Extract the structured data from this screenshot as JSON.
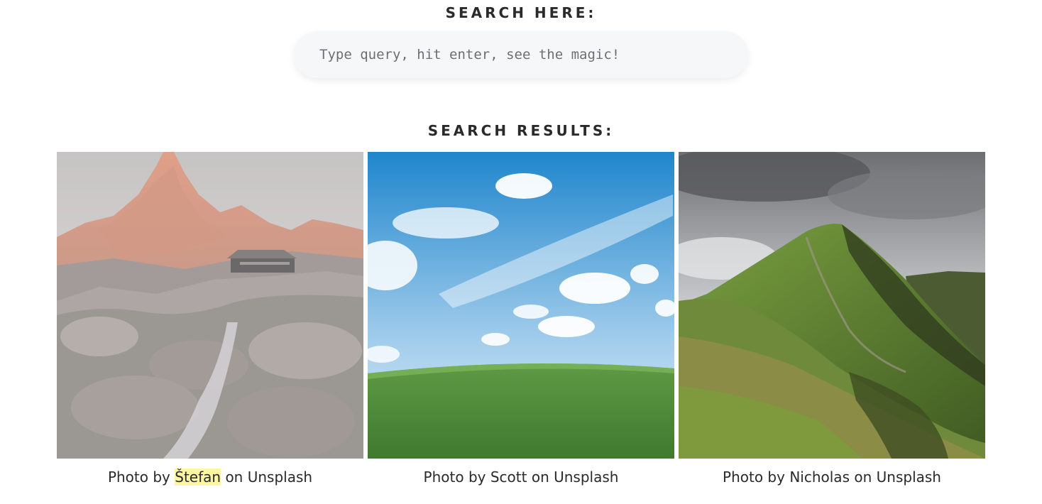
{
  "search": {
    "heading": "SEARCH HERE:",
    "placeholder": "Type query, hit enter, see the magic!",
    "value": ""
  },
  "results": {
    "heading": "SEARCH RESULTS:",
    "items": [
      {
        "prefix": "Photo by",
        "author": "Štefan",
        "middle": "on",
        "site": "Unsplash",
        "author_highlighted": true
      },
      {
        "prefix": "Photo by",
        "author": "Scott",
        "middle": "on",
        "site": "Unsplash",
        "author_highlighted": false
      },
      {
        "prefix": "Photo by",
        "author": "Nicholas",
        "middle": "on",
        "site": "Unsplash",
        "author_highlighted": false
      }
    ]
  },
  "colors": {
    "highlight": "#fdf6a3",
    "search_bg": "#f6f7f9",
    "text": "#2a2a2a"
  }
}
